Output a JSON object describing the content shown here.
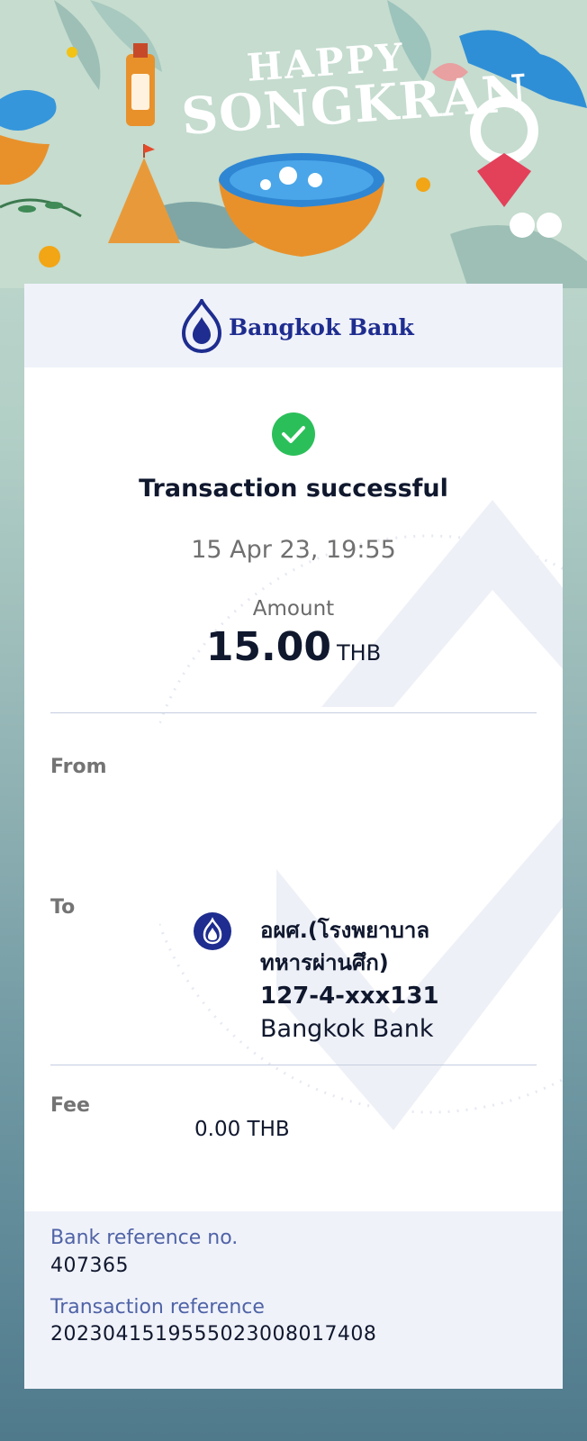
{
  "banner": {
    "line1": "HAPPY",
    "line2": "SONGKRAN"
  },
  "bank": {
    "name": "Bangkok Bank"
  },
  "status": {
    "title": "Transaction successful",
    "datetime": "15 Apr 23, 19:55",
    "icon": "check-circle-icon",
    "color": "#2bbf5a"
  },
  "amount": {
    "label": "Amount",
    "value": "15.00",
    "currency": "THB"
  },
  "from": {
    "label": "From"
  },
  "to": {
    "label": "To",
    "icon": "bangkok-bank-logo-icon",
    "name": "อผศ.(โรงพยาบาล ทหารผ่านศึก)",
    "account": "127-4-xxx131",
    "bank": "Bangkok Bank"
  },
  "fee": {
    "label": "Fee",
    "value": "0.00 THB"
  },
  "references": {
    "bank_ref_label": "Bank reference no.",
    "bank_ref_value": "407365",
    "txn_ref_label": "Transaction reference",
    "txn_ref_value": "2023041519555023008017408"
  },
  "colors": {
    "brand": "#1e2d8f",
    "label_blue": "#4f63a6"
  }
}
